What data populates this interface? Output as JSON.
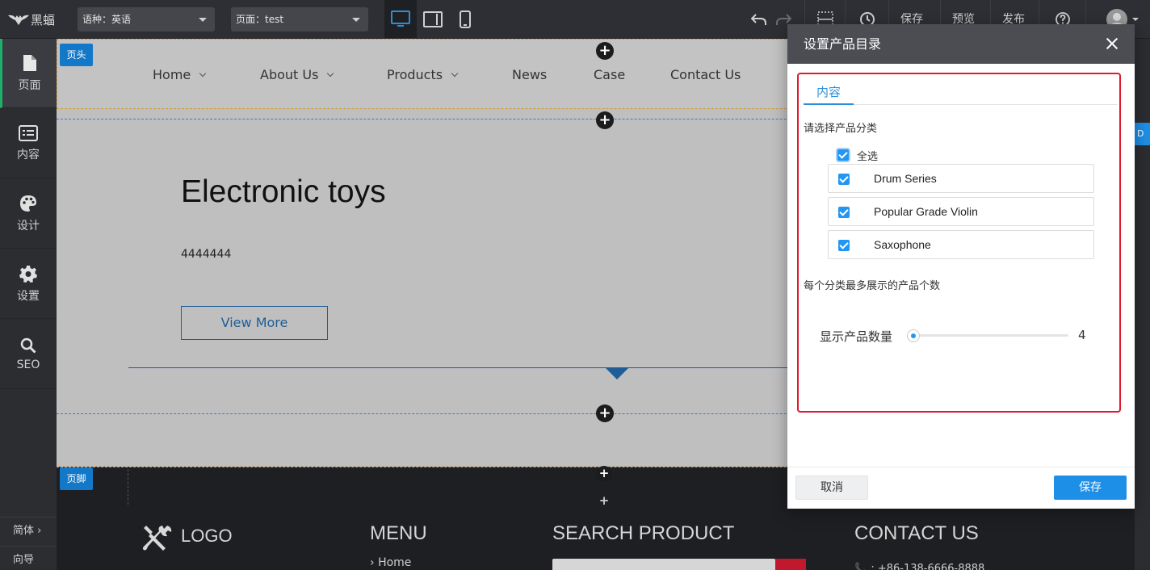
{
  "topbar": {
    "logo_text": "黑蝠",
    "language_select": "语种：英语",
    "page_select": "页面：test",
    "save": "保存",
    "preview": "预览",
    "publish": "发布"
  },
  "sidebar": {
    "items": [
      {
        "label": "页面",
        "icon": "page-icon"
      },
      {
        "label": "内容",
        "icon": "list-icon"
      },
      {
        "label": "设计",
        "icon": "palette-icon"
      },
      {
        "label": "设置",
        "icon": "gear-icon"
      },
      {
        "label": "SEO",
        "icon": "search-icon"
      }
    ],
    "language_toggle": "简体 ›",
    "guide": "向导"
  },
  "canvas": {
    "header_tag": "页头",
    "footer_tag": "页脚",
    "nav": [
      "Home",
      "About Us",
      "Products",
      "News",
      "Case",
      "Contact Us"
    ],
    "hero_title": "Electronic toys",
    "hero_text": "4444444",
    "view_more": "View More",
    "footer": {
      "logo": "LOGO",
      "menu_heading": "MENU",
      "menu_link": "Home",
      "search_heading": "SEARCH PRODUCT",
      "contact_heading": "CONTACT US",
      "phone": "+86-138-6666-8888"
    }
  },
  "modal": {
    "title": "设置产品目录",
    "tab": "内容",
    "choose_label": "请选择产品分类",
    "select_all": "全选",
    "categories": [
      {
        "name": "Drum Series",
        "checked": true
      },
      {
        "name": "Popular Grade Violin",
        "checked": true
      },
      {
        "name": "Saxophone",
        "checked": true
      }
    ],
    "max_label": "每个分类最多展示的产品个数",
    "count_label": "显示产品数量",
    "count_value": "4",
    "cancel": "取消",
    "save": "保存"
  },
  "colors": {
    "accent": "#1e8fe6",
    "highlight_border": "#e0192d",
    "active_sidebar": "#1eb06b"
  }
}
